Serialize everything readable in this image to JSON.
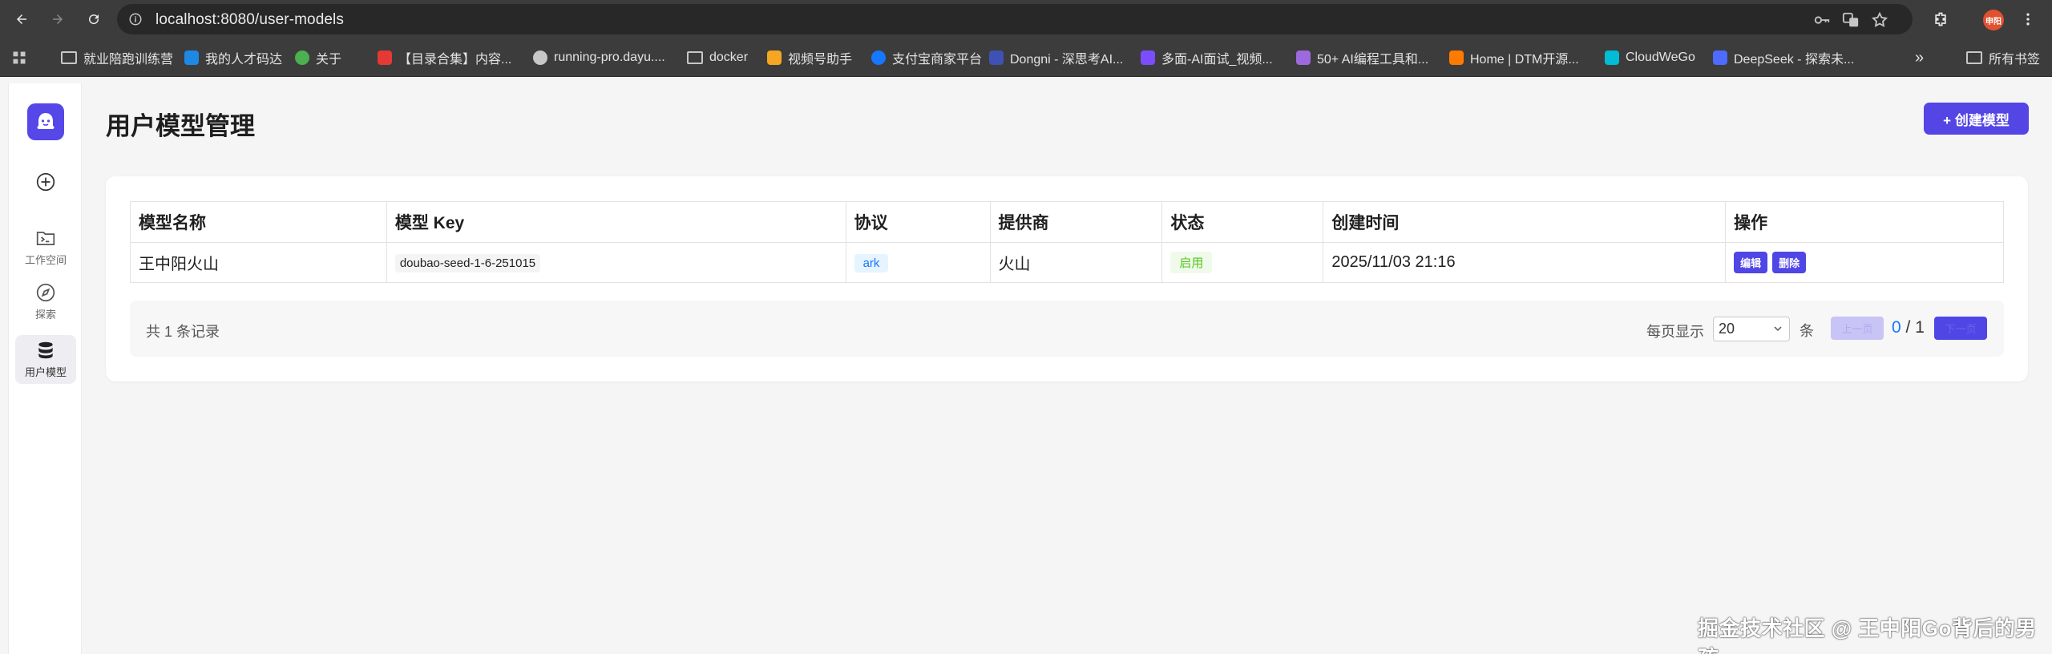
{
  "browser": {
    "url": "localhost:8080/user-models",
    "profile_initials": "申阳",
    "bookmarks": [
      {
        "label": "就业陪跑训练营",
        "icon": "folder-icon",
        "color": "#c7c7c7"
      },
      {
        "label": "我的人才码达",
        "icon": "app-icon",
        "color": "#1e88e5"
      },
      {
        "label": "关于",
        "icon": "profile-icon",
        "color": "#4caf50"
      },
      {
        "label": "【目录合集】内容...",
        "icon": "book-icon",
        "color": "#e53935"
      },
      {
        "label": "running-pro.dayu....",
        "icon": "globe-icon",
        "color": "#c7c7c7"
      },
      {
        "label": "docker",
        "icon": "folder-icon",
        "color": "#c7c7c7"
      },
      {
        "label": "视频号助手",
        "icon": "video-icon",
        "color": "#f5a623"
      },
      {
        "label": "支付宝商家平台",
        "icon": "alipay-icon",
        "color": "#1677ff"
      },
      {
        "label": "Dongni - 深思考AI...",
        "icon": "grid-icon",
        "color": "#3f51b5"
      },
      {
        "label": "多面-AI面试_视频...",
        "icon": "app-icon",
        "color": "#7c4dff"
      },
      {
        "label": "50+ AI编程工具和...",
        "icon": "mountain-icon",
        "color": "#9c6ade"
      },
      {
        "label": "Home | DTM开源...",
        "icon": "app-icon",
        "color": "#ff7a00"
      },
      {
        "label": "CloudWeGo",
        "icon": "cloud-icon",
        "color": "#00bcd4"
      },
      {
        "label": "DeepSeek - 探索未...",
        "icon": "whale-icon",
        "color": "#4d6bfe"
      }
    ],
    "all_bookmarks_label": "所有书签"
  },
  "sidebar": {
    "items": [
      {
        "label": "",
        "icon": "plus-circle-icon"
      },
      {
        "label": "工作空间",
        "icon": "terminal-folder-icon"
      },
      {
        "label": "探索",
        "icon": "compass-icon"
      },
      {
        "label": "用户模型",
        "icon": "database-icon"
      }
    ]
  },
  "page": {
    "title": "用户模型管理",
    "create_button": "+ 创建模型"
  },
  "table": {
    "headers": [
      "模型名称",
      "模型 Key",
      "协议",
      "提供商",
      "状态",
      "创建时间",
      "操作"
    ],
    "rows": [
      {
        "name": "王中阳火山",
        "key": "doubao-seed-1-6-251015",
        "protocol": "ark",
        "provider": "火山",
        "status": "启用",
        "created": "2025/11/03 21:16",
        "edit": "编辑",
        "delete": "删除"
      }
    ]
  },
  "pagination": {
    "total": "共 1 条记录",
    "per_page_label": "每页显示",
    "per_page_value": "20",
    "unit": "条",
    "prev": "上一页",
    "current": "0",
    "separator": " / ",
    "pages": "1",
    "next": "下一页"
  },
  "watermark": "掘金技术社区 @ 王中阳Go背后的男孩"
}
